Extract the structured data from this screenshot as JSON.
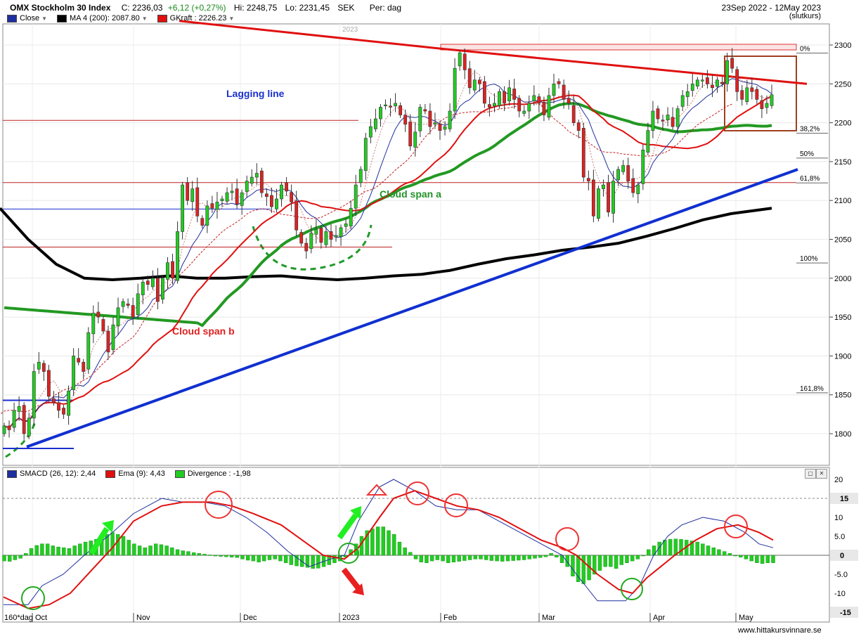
{
  "header": {
    "title": "OMX Stockholm 30 Index",
    "close_label": "C: 2236,03",
    "change_label": "+6,12 (+0,27%)",
    "high_label": "Hi: 2248,75",
    "low_label": "Lo: 2231,45",
    "currency": "SEK",
    "period": "Per: dag",
    "date_range": "23Sep 2022 - 12May 2023",
    "price_basis": "(slutkurs)"
  },
  "legend_top": [
    {
      "label": "Close",
      "color": "#1f2f9f"
    },
    {
      "label": "MA 4 (200): 2087.80",
      "color": "#000000"
    },
    {
      "label": "GKraft : 2226.23",
      "color": "#e01010"
    }
  ],
  "legend_bottom": [
    {
      "label": "SMACD (26, 12): 2,44",
      "color": "#1f2f9f"
    },
    {
      "label": "Ema (9): 4,43",
      "color": "#e01010"
    },
    {
      "label": "Divergence : -1,98",
      "color": "#22cc22"
    }
  ],
  "footer": {
    "source": "www.hittakursvinnare.se",
    "timeframe": "160*dag"
  },
  "colors": {
    "up": "#22cc22",
    "down": "#dd2222",
    "ma200": "#000000",
    "trend_up": "#1030d0",
    "trend_down": "#e01010",
    "cloud_a": "#229922"
  },
  "chart_data": [
    {
      "type": "candlestick",
      "title": "OMX Stockholm 30 Index",
      "x_tick_labels": [
        "Oct",
        "Nov",
        "Dec",
        "2023",
        "Feb",
        "Mar",
        "Apr",
        "May"
      ],
      "period_label": "2023",
      "y_tick_labels": [
        "1800",
        "1850",
        "1900",
        "1950",
        "2000",
        "2050",
        "2100",
        "2150",
        "2200",
        "2250",
        "2300"
      ],
      "ylim": [
        1760,
        2320
      ],
      "annotations": [
        "Lagging line",
        "Cloud span a",
        "Cloud span b"
      ],
      "fibonacci_levels": [
        {
          "label": "0%",
          "value": 2295
        },
        {
          "label": "38,2%",
          "value": 2192
        },
        {
          "label": "50%",
          "value": 2160
        },
        {
          "label": "61,8%",
          "value": 2128
        },
        {
          "label": "100%",
          "value": 2025
        },
        {
          "label": "161,8%",
          "value": 1858
        }
      ],
      "horizontal_levels": [
        2203,
        2123,
        2089,
        2040,
        1843,
        1781
      ],
      "approx_closes": [
        1810,
        1805,
        1830,
        1835,
        1800,
        1820,
        1880,
        1892,
        1880,
        1848,
        1840,
        1830,
        1825,
        1855,
        1900,
        1892,
        1880,
        1930,
        1955,
        1950,
        1932,
        1905,
        1940,
        1962,
        1970,
        1965,
        1950,
        1980,
        1995,
        1992,
        2000,
        1970,
        2000,
        2020,
        2000,
        2060,
        2120,
        2100,
        2115,
        2080,
        2068,
        2093,
        2090,
        2098,
        2102,
        2110,
        2112,
        2095,
        2110,
        2125,
        2130,
        2135,
        2110,
        2105,
        2092,
        2102,
        2120,
        2112,
        2098,
        2062,
        2045,
        2035,
        2058,
        2063,
        2046,
        2060,
        2050,
        2055,
        2065,
        2070,
        2090,
        2120,
        2140,
        2180,
        2195,
        2205,
        2220,
        2223,
        2220,
        2225,
        2210,
        2198,
        2170,
        2188,
        2220,
        2215,
        2195,
        2200,
        2190,
        2195,
        2215,
        2270,
        2290,
        2268,
        2245,
        2255,
        2250,
        2225,
        2220,
        2225,
        2240,
        2225,
        2245,
        2230,
        2215,
        2215,
        2225,
        2235,
        2225,
        2210,
        2235,
        2250,
        2250,
        2230,
        2225,
        2200,
        2190,
        2130,
        2125,
        2080,
        2115,
        2120,
        2085,
        2125,
        2140,
        2145,
        2125,
        2110,
        2120,
        2165,
        2190,
        2215,
        2205,
        2202,
        2210,
        2195,
        2218,
        2235,
        2240,
        2250,
        2255,
        2255,
        2250,
        2245,
        2255,
        2250,
        2280,
        2270,
        2240,
        2230,
        2245,
        2240,
        2230,
        2218,
        2225,
        2236
      ],
      "series": [
        {
          "name": "MA 4 (200)",
          "ylim_points": [
            [
              0,
              2090
            ],
            [
              40,
              2050
            ],
            [
              80,
              2018
            ],
            [
              120,
              2000
            ],
            [
              160,
              1998
            ],
            [
              200,
              2000
            ],
            [
              240,
              2003
            ],
            [
              280,
              2000
            ],
            [
              320,
              2000
            ],
            [
              360,
              2002
            ],
            [
              400,
              2003
            ],
            [
              440,
              2000
            ],
            [
              480,
              1998
            ],
            [
              520,
              2000
            ],
            [
              560,
              2003
            ],
            [
              600,
              2005
            ],
            [
              640,
              2010
            ],
            [
              680,
              2018
            ],
            [
              720,
              2025
            ],
            [
              760,
              2030
            ],
            [
              800,
              2036
            ],
            [
              840,
              2040
            ],
            [
              880,
              2045
            ],
            [
              920,
              2054
            ],
            [
              960,
              2064
            ],
            [
              1000,
              2075
            ],
            [
              1040,
              2083
            ],
            [
              1098,
              2090
            ]
          ]
        },
        {
          "name": "GKraft",
          "ylim_points": [
            [
              255,
              2331
            ],
            [
              630,
              2295
            ],
            [
              1148,
              2250
            ]
          ]
        }
      ]
    },
    {
      "type": "line+bar",
      "title": "SMACD",
      "y_tick_labels": [
        "20",
        "15",
        "10",
        "5.0",
        "0",
        "-5.0",
        "-10",
        "-15"
      ],
      "ylim": [
        -17,
        21
      ],
      "series": [
        {
          "name": "SMACD (26, 12)",
          "points": [
            [
              5,
              -13
            ],
            [
              40,
              -13
            ],
            [
              60,
              -8
            ],
            [
              90,
              -5
            ],
            [
              120,
              0
            ],
            [
              160,
              6
            ],
            [
              190,
              11
            ],
            [
              230,
              15
            ],
            [
              260,
              14
            ],
            [
              290,
              14
            ],
            [
              320,
              13
            ],
            [
              350,
              10
            ],
            [
              380,
              6
            ],
            [
              410,
              1
            ],
            [
              440,
              -3
            ],
            [
              470,
              -1
            ],
            [
              490,
              0
            ],
            [
              510,
              9
            ],
            [
              540,
              18
            ],
            [
              560,
              20
            ],
            [
              590,
              17
            ],
            [
              620,
              13
            ],
            [
              650,
              12
            ],
            [
              680,
              12
            ],
            [
              710,
              9
            ],
            [
              740,
              6
            ],
            [
              770,
              3
            ],
            [
              800,
              0
            ],
            [
              820,
              -5
            ],
            [
              850,
              -12
            ],
            [
              870,
              -12
            ],
            [
              890,
              -12
            ],
            [
              910,
              -8
            ],
            [
              930,
              0
            ],
            [
              950,
              5
            ],
            [
              970,
              8
            ],
            [
              1000,
              10
            ],
            [
              1030,
              9
            ],
            [
              1060,
              6
            ],
            [
              1080,
              3
            ],
            [
              1100,
              2
            ]
          ]
        },
        {
          "name": "Ema (9)",
          "points": [
            [
              5,
              -11
            ],
            [
              40,
              -14
            ],
            [
              70,
              -13
            ],
            [
              100,
              -10
            ],
            [
              130,
              -4
            ],
            [
              160,
              2
            ],
            [
              190,
              9
            ],
            [
              230,
              13
            ],
            [
              260,
              14
            ],
            [
              300,
              14
            ],
            [
              330,
              13
            ],
            [
              360,
              11
            ],
            [
              400,
              8
            ],
            [
              430,
              4
            ],
            [
              460,
              0
            ],
            [
              490,
              -1
            ],
            [
              510,
              2
            ],
            [
              540,
              10
            ],
            [
              560,
              15
            ],
            [
              590,
              17
            ],
            [
              620,
              15
            ],
            [
              650,
              13
            ],
            [
              680,
              12
            ],
            [
              710,
              10
            ],
            [
              740,
              7
            ],
            [
              770,
              4
            ],
            [
              800,
              2
            ],
            [
              820,
              0
            ],
            [
              850,
              -5
            ],
            [
              880,
              -9
            ],
            [
              900,
              -10
            ],
            [
              920,
              -6
            ],
            [
              940,
              -3
            ],
            [
              960,
              0
            ],
            [
              990,
              4
            ],
            [
              1020,
              7
            ],
            [
              1050,
              8
            ],
            [
              1080,
              6
            ],
            [
              1100,
              4
            ]
          ]
        }
      ],
      "divergence": [
        -1.5,
        -1.6,
        -1.2,
        -0.8,
        0.5,
        1.8,
        2.6,
        3.0,
        3.0,
        2.5,
        2.2,
        2.0,
        1.8,
        2.5,
        3.0,
        3.5,
        3.8,
        4.2,
        5.0,
        5.5,
        6.0,
        5.5,
        5.0,
        4.0,
        3.0,
        2.5,
        2.0,
        2.5,
        3.0,
        2.8,
        2.5,
        2.0,
        1.5,
        1.2,
        1.0,
        0.7,
        0.5,
        0.3,
        0.1,
        -0.2,
        -0.3,
        -0.4,
        -0.5,
        -0.6,
        -1.0,
        -1.3,
        -1.5,
        -1.8,
        -1.5,
        -1.2,
        -1.0,
        -1.5,
        -2.0,
        -2.5,
        -2.8,
        -3.0,
        -3.2,
        -3.5,
        -3.4,
        -3.0,
        -2.5,
        -2.0,
        -1.5,
        -0.5,
        1.5,
        3.0,
        5.0,
        6.5,
        7.0,
        7.5,
        7.5,
        6.5,
        5.5,
        3.5,
        2.0,
        0.8,
        -1.0,
        -1.8,
        -2.0,
        -1.5,
        -1.2,
        -1.5,
        -2.0,
        -1.8,
        -1.6,
        -1.4,
        -1.2,
        -1.0,
        -1.0,
        -1.2,
        -1.4,
        -1.5,
        -1.6,
        -1.5,
        -1.4,
        -1.3,
        -1.2,
        -1.0,
        -0.8,
        -0.6,
        -0.4,
        0.5,
        -0.5,
        -2.0,
        -3.0,
        -5.5,
        -7.0,
        -7.5,
        -6.5,
        -5.0,
        -4.0,
        -3.0,
        -3.0,
        -3.5,
        -2.5,
        -2.0,
        -1.5,
        -1.0,
        0.0,
        1.5,
        2.5,
        3.5,
        4.0,
        4.2,
        4.3,
        4.2,
        4.0,
        3.8,
        3.5,
        3.0,
        2.5,
        2.0,
        1.5,
        1.0,
        0.5,
        0.0,
        -0.5,
        -1.0,
        -1.5,
        -2.0,
        -2.2,
        -2.0,
        -1.98
      ]
    }
  ]
}
